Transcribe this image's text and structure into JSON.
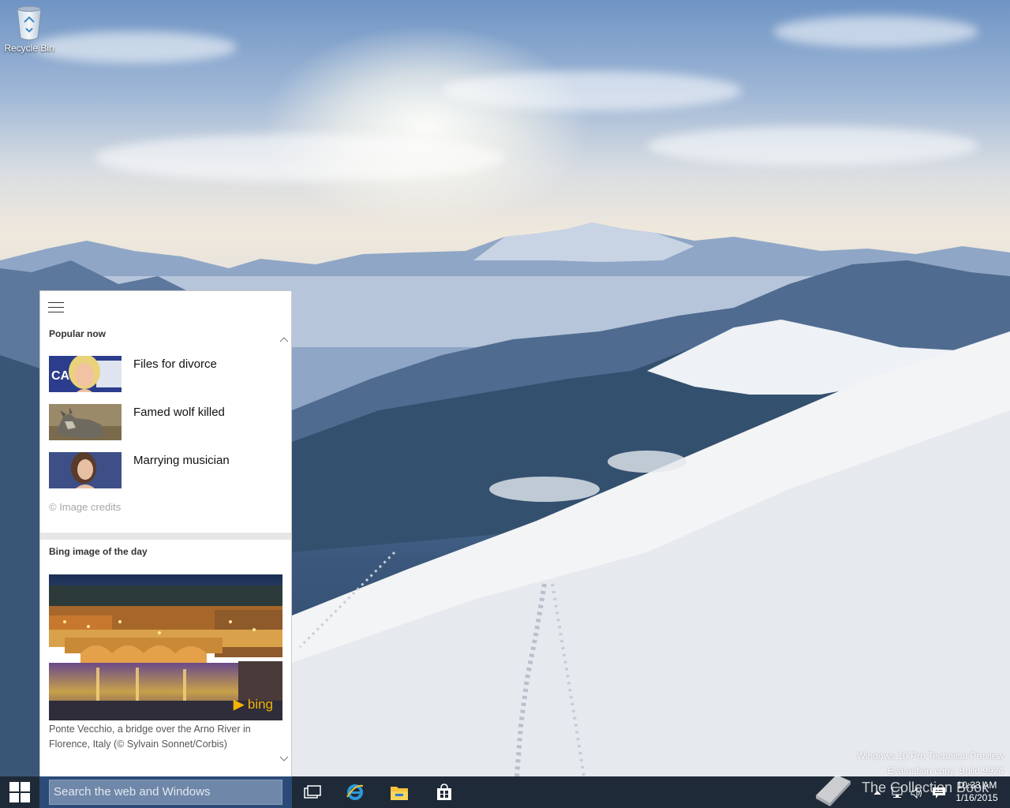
{
  "desktop": {
    "icons": [
      {
        "label": "Recycle Bin",
        "icon": "recycle-bin-icon"
      }
    ],
    "watermark": {
      "line1": "Windows 10 Pro Technical Preview",
      "line2": "Evaluation copy. Build 9924"
    },
    "overlay_logo": "The Collection Book"
  },
  "search_panel": {
    "menu_icon": "hamburger-menu-icon",
    "popular_title": "Popular now",
    "news": [
      {
        "label": "Files for divorce",
        "thumb": "woman-blonde-photo"
      },
      {
        "label": "Famed wolf killed",
        "thumb": "wolf-photo"
      },
      {
        "label": "Marrying musician",
        "thumb": "woman-brunette-photo"
      }
    ],
    "image_credits": "© Image credits",
    "bing_title": "Bing image of the day",
    "bing_logo_text": "bing",
    "bing_caption": "Ponte Vecchio, a bridge over the Arno River in Florence, Italy (© Sylvain Sonnet/Corbis)"
  },
  "taskbar": {
    "search_placeholder": "Search the web and Windows",
    "pinned": [
      {
        "name": "task-view",
        "icon": "task-view-icon"
      },
      {
        "name": "internet-explorer",
        "icon": "internet-explorer-icon"
      },
      {
        "name": "file-explorer",
        "icon": "file-explorer-icon"
      },
      {
        "name": "store",
        "icon": "store-icon"
      }
    ],
    "tray": {
      "icons": [
        "show-hidden-icons-chevron",
        "network-icon",
        "volume-icon",
        "action-center-icon"
      ],
      "time": "10:33 AM",
      "date": "1/16/2015"
    }
  },
  "colors": {
    "taskbar": "#1f2a38",
    "search_box": "#6f87a8",
    "bing_accent": "#f5b400"
  }
}
